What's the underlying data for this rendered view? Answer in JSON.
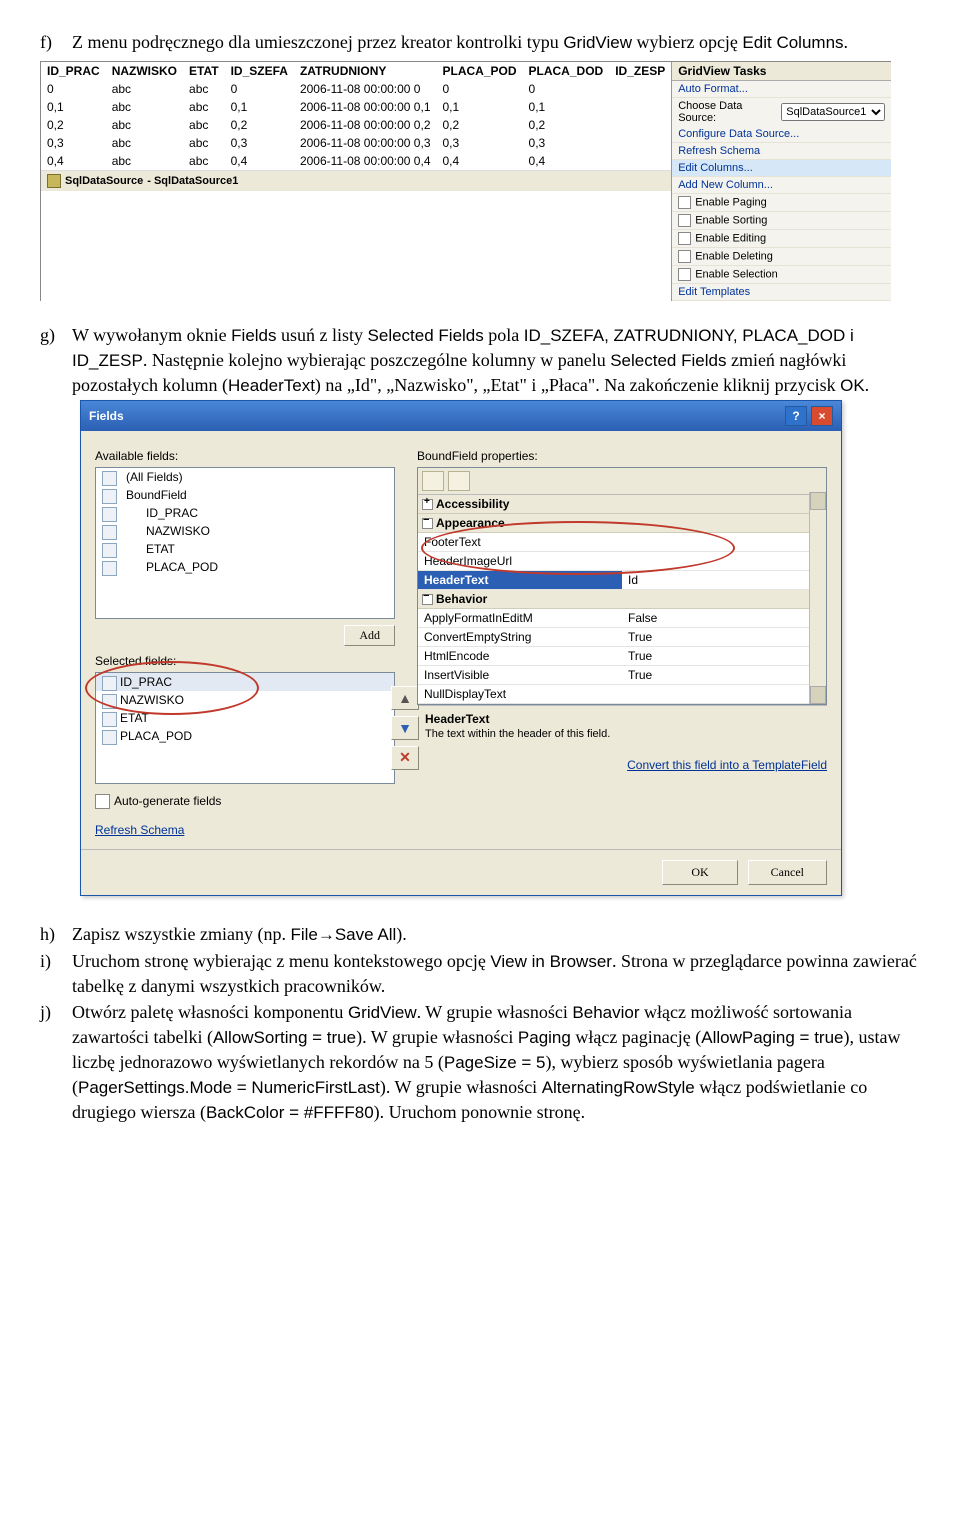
{
  "step_f": {
    "marker": "f)",
    "pre": "Z menu podręcznego dla umieszczonej przez kreator kontrolki typu ",
    "t1": "GridView",
    "mid": " wybierz opcję ",
    "t2": "Edit Columns",
    "end": "."
  },
  "shot1": {
    "headers": [
      "ID_PRAC",
      "NAZWISKO",
      "ETAT",
      "ID_SZEFA",
      "ZATRUDNIONY",
      "PLACA_POD",
      "PLACA_DOD",
      "ID_ZESP"
    ],
    "rows": [
      [
        "0",
        "abc",
        "abc",
        "0",
        "2006-11-08 00:00:00 0",
        "0",
        "0"
      ],
      [
        "0,1",
        "abc",
        "abc",
        "0,1",
        "2006-11-08 00:00:00 0,1",
        "0,1",
        "0,1"
      ],
      [
        "0,2",
        "abc",
        "abc",
        "0,2",
        "2006-11-08 00:00:00 0,2",
        "0,2",
        "0,2"
      ],
      [
        "0,3",
        "abc",
        "abc",
        "0,3",
        "2006-11-08 00:00:00 0,3",
        "0,3",
        "0,3"
      ],
      [
        "0,4",
        "abc",
        "abc",
        "0,4",
        "2006-11-08 00:00:00 0,4",
        "0,4",
        "0,4"
      ]
    ],
    "datasource_label": "SqlDataSource",
    "datasource_value": " - SqlDataSource1",
    "tasks_title": "GridView Tasks",
    "auto_format": "Auto Format...",
    "choose_ds": "Choose Data Source:",
    "ds_combo": "SqlDataSource1",
    "configure": "Configure Data Source...",
    "refresh": "Refresh Schema",
    "edit_columns": "Edit Columns...",
    "add_new": "Add New Column...",
    "enable_paging": "Enable Paging",
    "enable_sorting": "Enable Sorting",
    "enable_editing": "Enable Editing",
    "enable_deleting": "Enable Deleting",
    "enable_selection": "Enable Selection",
    "edit_templates": "Edit Templates"
  },
  "step_g": {
    "marker": "g)",
    "t1": "W wywołanym oknie ",
    "fields": "Fields",
    "t2": " usuń z listy ",
    "selected": "Selected Fields",
    "t3": " pola ",
    "fields_list": "ID_SZEFA, ZATRUDNIONY, PLACA_DOD i ID_ZESP",
    "t4": ". Następnie kolejno wybierając poszczególne kolumny w panelu ",
    "selected2": "Selected Fields",
    "t5": " zmień nagłówki pozostałych kolumn (",
    "headertext": "HeaderText",
    "t6": ") na „Id\", „Nazwisko\", „Etat\" i „Płaca\". Na zakończenie kliknij przycisk ",
    "ok": "OK",
    "t7": "."
  },
  "shot2": {
    "title": "Fields",
    "available": "Available fields:",
    "tree": [
      "(All Fields)",
      "BoundField",
      "ID_PRAC",
      "NAZWISKO",
      "ETAT",
      "PLACA_POD"
    ],
    "add": "Add",
    "selected_label": "Selected fields:",
    "selected": [
      "ID_PRAC",
      "NAZWISKO",
      "ETAT",
      "PLACA_POD"
    ],
    "autogen": "Auto-generate fields",
    "refresh": "Refresh Schema",
    "bound_label": "BoundField properties:",
    "cat_access": "Accessibility",
    "cat_appear": "Appearance",
    "p_footer": "FooterText",
    "p_headerimg": "HeaderImageUrl",
    "p_headertext": "HeaderText",
    "p_headertext_v": "Id",
    "cat_behavior": "Behavior",
    "p_apply": "ApplyFormatInEditM",
    "p_apply_v": "False",
    "p_convert": "ConvertEmptyString",
    "p_convert_v": "True",
    "p_htmlenc": "HtmlEncode",
    "p_htmlenc_v": "True",
    "p_insertvis": "InsertVisible",
    "p_insertvis_v": "True",
    "p_nulltext": "NullDisplayText",
    "desc_title": "HeaderText",
    "desc_body": "The text within the header of this field.",
    "convert_link": "Convert this field into a TemplateField",
    "ok": "OK",
    "cancel": "Cancel"
  },
  "step_h": {
    "marker": "h)",
    "t1": "Zapisz wszystkie zmiany (np. ",
    "cmd": "File→Save All",
    "t2": ")."
  },
  "step_i": {
    "marker": "i)",
    "t1": "Uruchom stronę wybierając z menu kontekstowego opcję ",
    "cmd": "View in Browser",
    "t2": ". Strona w przeglądarce powinna zawierać tabelkę z danymi wszystkich pracowników."
  },
  "step_j": {
    "marker": "j)",
    "t1": "Otwórz paletę własności komponentu ",
    "gridview": "GridView",
    "t2": ". W grupie własności ",
    "behavior": "Behavior",
    "t3": " włącz możliwość sortowania zawartości tabelki (",
    "allowsort": "AllowSorting = true",
    "t4": "). W grupie własności ",
    "paging": "Paging",
    "t5": " włącz paginację (",
    "allowpage": "AllowPaging = true",
    "t6": "), ustaw liczbę jednorazowo wyświetlanych rekordów na 5 (",
    "pagesize": "PageSize = 5",
    "t7": "), wybierz sposób wyświetlania pagera (",
    "pagerset": "PagerSettings.Mode = NumericFirstLast",
    "t8": "). W grupie własności ",
    "altrow": "AlternatingRowStyle",
    "t9": " włącz podświetlanie co drugiego wiersza (",
    "backcolor": "BackColor = #FFFF80",
    "t10": "). Uruchom ponownie stronę."
  }
}
